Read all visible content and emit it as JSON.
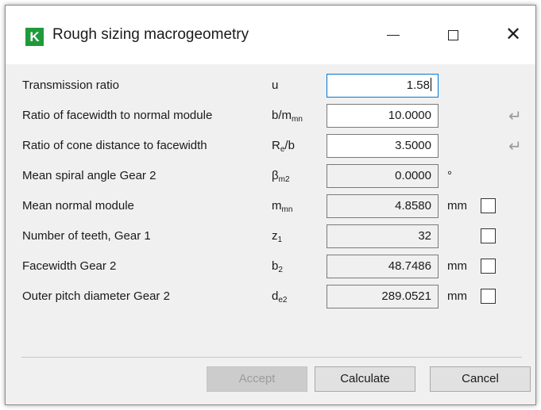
{
  "window": {
    "title": "Rough sizing macrogeometry",
    "icon_letter": "K",
    "icon_color": "#1f9a3a"
  },
  "rows": [
    {
      "label": "Transmission ratio",
      "symbol": "u",
      "sub": "",
      "value": "1.58",
      "unit": "",
      "editable": true,
      "focused": true
    },
    {
      "label": "Ratio of facewidth to normal module",
      "symbol": "b/m",
      "sub": "mn",
      "value": "10.0000",
      "unit": "",
      "editable": true
    },
    {
      "label": "Ratio of cone distance to facewidth",
      "symbol": "R",
      "sub": "e",
      "symbol_tail": "/b",
      "value": "3.5000",
      "unit": "",
      "editable": true
    },
    {
      "label": "Mean spiral angle Gear 2",
      "symbol": "β",
      "sub": "m2",
      "value": "0.0000",
      "unit": "°",
      "editable": false
    },
    {
      "label": "Mean normal module",
      "symbol": "m",
      "sub": "mn",
      "value": "4.8580",
      "unit": "mm",
      "editable": false,
      "checked": false
    },
    {
      "label": "Number of teeth, Gear 1",
      "symbol": "z",
      "sub": "1",
      "value": "32",
      "unit": "",
      "editable": false,
      "checked": false
    },
    {
      "label": "Facewidth Gear 2",
      "symbol": "b",
      "sub": "2",
      "value": "48.7486",
      "unit": "mm",
      "editable": false,
      "checked": false
    },
    {
      "label": "Outer pitch diameter Gear 2",
      "symbol": "d",
      "sub": "e2",
      "value": "289.0521",
      "unit": "mm",
      "editable": false,
      "checked": false
    }
  ],
  "buttons": {
    "accept": "Accept",
    "calculate": "Calculate",
    "cancel": "Cancel"
  },
  "icons": {
    "enter": "↵",
    "close": "✕"
  }
}
